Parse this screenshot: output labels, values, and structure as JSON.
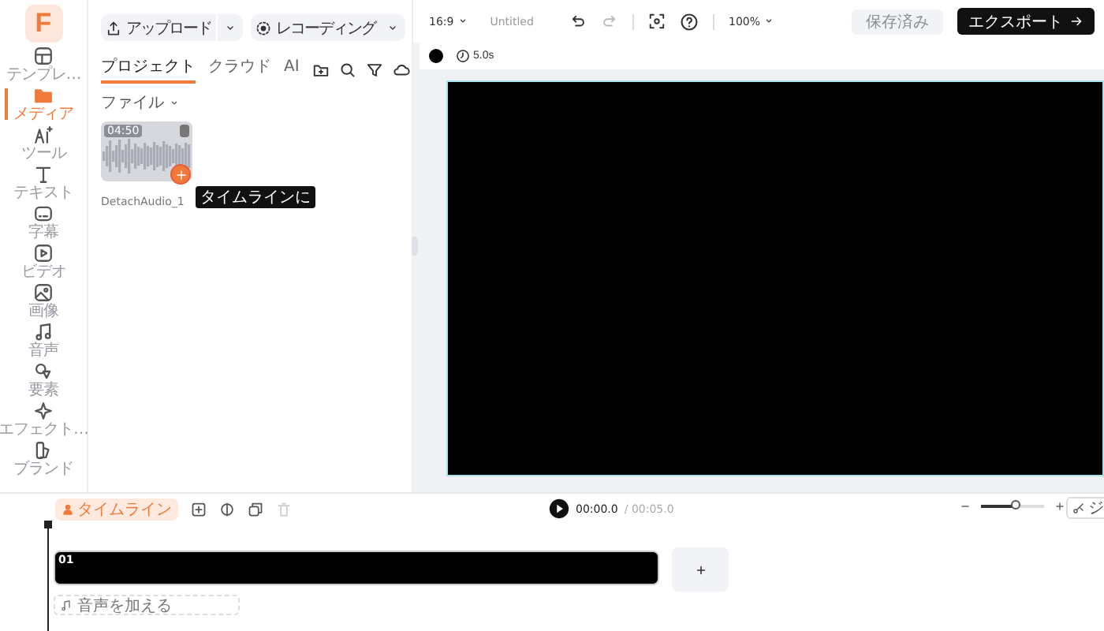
{
  "rail": {
    "logo": "F",
    "items": [
      {
        "kind": "template",
        "label": "テンプレ…",
        "selected": false
      },
      {
        "kind": "media",
        "label": "メディア",
        "selected": true
      },
      {
        "kind": "tools",
        "label": "ツール",
        "selected": false
      },
      {
        "kind": "text",
        "label": "テキスト",
        "selected": false
      },
      {
        "kind": "subtitle",
        "label": "字幕",
        "selected": false
      },
      {
        "kind": "video",
        "label": "ビデオ",
        "selected": false
      },
      {
        "kind": "image",
        "label": "画像",
        "selected": false
      },
      {
        "kind": "audio",
        "label": "音声",
        "selected": false
      },
      {
        "kind": "elements",
        "label": "要素",
        "selected": false
      },
      {
        "kind": "effects",
        "label": "エフェクト…",
        "selected": false
      },
      {
        "kind": "brand",
        "label": "ブランド",
        "selected": false
      }
    ]
  },
  "panel": {
    "upload": "アップロード",
    "record": "レコーディング",
    "tabs": [
      {
        "label": "プロジェクト",
        "selected": true
      },
      {
        "label": "クラウド",
        "selected": false
      },
      {
        "label": "AI",
        "selected": false
      }
    ],
    "folder": "ファイル",
    "media": [
      {
        "duration": "04:50",
        "name": "DetachAudio_1",
        "tooltip": "タイムラインに"
      }
    ]
  },
  "topbar": {
    "ratio": "16:9",
    "title": "Untitled",
    "zoom": "100%",
    "save": {
      "label": "保存済み",
      "disabled": true
    },
    "export": "エクスポート"
  },
  "canvas": {
    "duration": "5.0s"
  },
  "timeline": {
    "tab": "タイムライン",
    "time": "00:00.0",
    "total": "/ 00:05.0",
    "zoom": {
      "level": 0.55
    },
    "clip": "01",
    "add_audio": "音声を加える",
    "split": "ジ"
  }
}
